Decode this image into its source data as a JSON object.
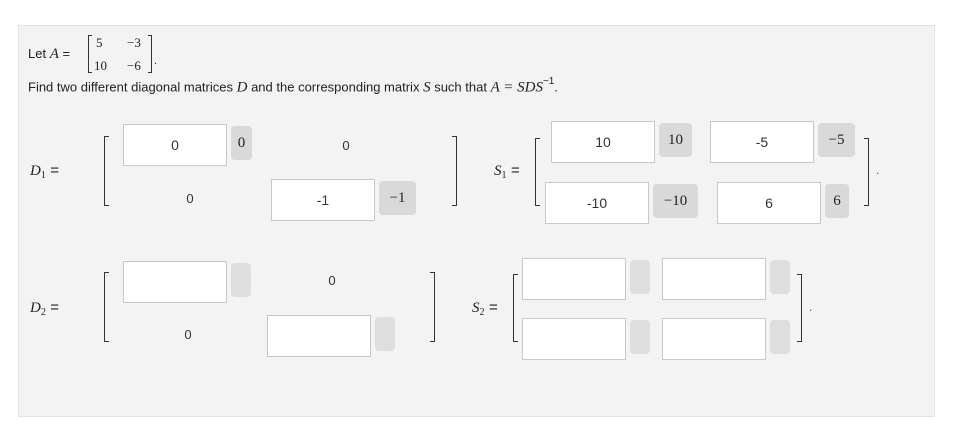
{
  "intro": {
    "let_text": "Let",
    "a_symbol": "A",
    "equals": "=",
    "matrix_a": {
      "r1c1": "5",
      "r1c2": "−3",
      "r2c1": "10",
      "r2c2": "−6"
    },
    "period": ".",
    "instruction_before": "Find two different diagonal matrices",
    "d_symbol": "D",
    "instruction_mid": "and the corresponding matrix",
    "s_symbol": "S",
    "instruction_after": "such that",
    "equation": "A = SDS",
    "inverse_exp": "−1",
    "end_period": "."
  },
  "d1": {
    "label": "D",
    "label_sub": "1",
    "label_eq": "=",
    "r1c1_input": "0",
    "r1c1_preview": "0",
    "r1c2_static": "0",
    "r2c1_static": "0",
    "r2c2_input": "-1",
    "r2c2_preview": "−1"
  },
  "s1": {
    "label": "S",
    "label_sub": "1",
    "label_eq": "=",
    "r1c1_input": "10",
    "r1c1_preview": "10",
    "r1c2_input": "-5",
    "r1c2_preview": "−5",
    "r2c1_input": "-10",
    "r2c1_preview": "−10",
    "r2c2_input": "6",
    "r2c2_preview": "6",
    "trailing_dot": "."
  },
  "d2": {
    "label": "D",
    "label_sub": "2",
    "label_eq": "=",
    "r1c1_input": "",
    "r1c2_static": "0",
    "r2c1_static": "0",
    "r2c2_input": ""
  },
  "s2": {
    "label": "S",
    "label_sub": "2",
    "label_eq": "=",
    "r1c1_input": "",
    "r1c2_input": "",
    "r2c1_input": "",
    "r2c2_input": "",
    "trailing_dot": "."
  },
  "colors": {
    "panel_bg": "#f3f3f3",
    "chip_bg": "#d9d9d9",
    "input_border": "#c8c8c8"
  }
}
